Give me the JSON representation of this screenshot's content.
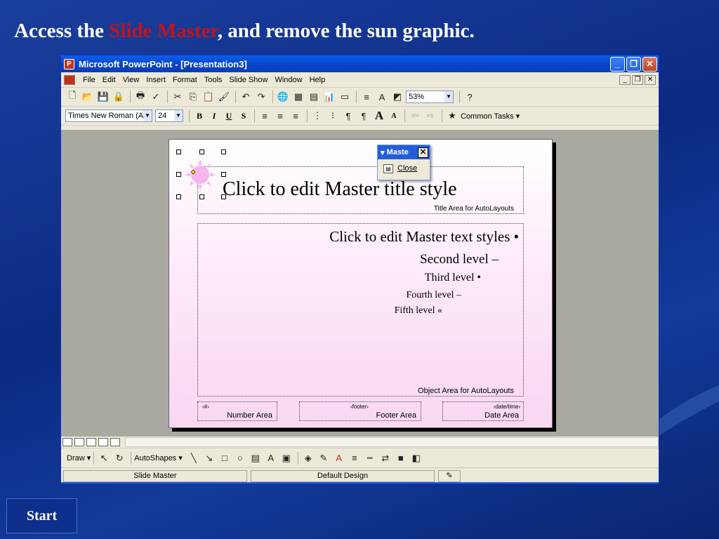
{
  "heading": {
    "prefix": "Access the ",
    "highlight": "Slide Master",
    "suffix": ", and remove the sun graphic."
  },
  "window": {
    "title": "Microsoft PowerPoint - [Presentation3]"
  },
  "menu": [
    "File",
    "Edit",
    "View",
    "Insert",
    "Format",
    "Tools",
    "Slide Show",
    "Window",
    "Help"
  ],
  "toolbar": {
    "zoom": "53%"
  },
  "format_toolbar": {
    "font": "Times New Roman (A",
    "size": "24",
    "common_tasks": "Common Tasks ▾"
  },
  "slide": {
    "title": "Click to edit Master title style",
    "title_area_label": "Title Area for AutoLayouts",
    "levels": [
      "Click to edit Master text styles  •",
      "Second level –",
      "Third level •",
      "Fourth level –",
      "Fifth level «"
    ],
    "object_area_label": "Object Area for AutoLayouts",
    "number_placeholder": "‹#›",
    "number_area": "Number Area",
    "footer_placeholder": "‹footer›",
    "footer_area": "Footer Area",
    "date_placeholder": "‹date/time›",
    "date_area": "Date Area"
  },
  "master_toolbar": {
    "title": "Maste",
    "close_label": "Close"
  },
  "drawbar": {
    "draw": "Draw ▾",
    "autoshapes": "AutoShapes ▾"
  },
  "status": {
    "view": "Slide Master",
    "design": "Default Design"
  },
  "start_button": "Start"
}
